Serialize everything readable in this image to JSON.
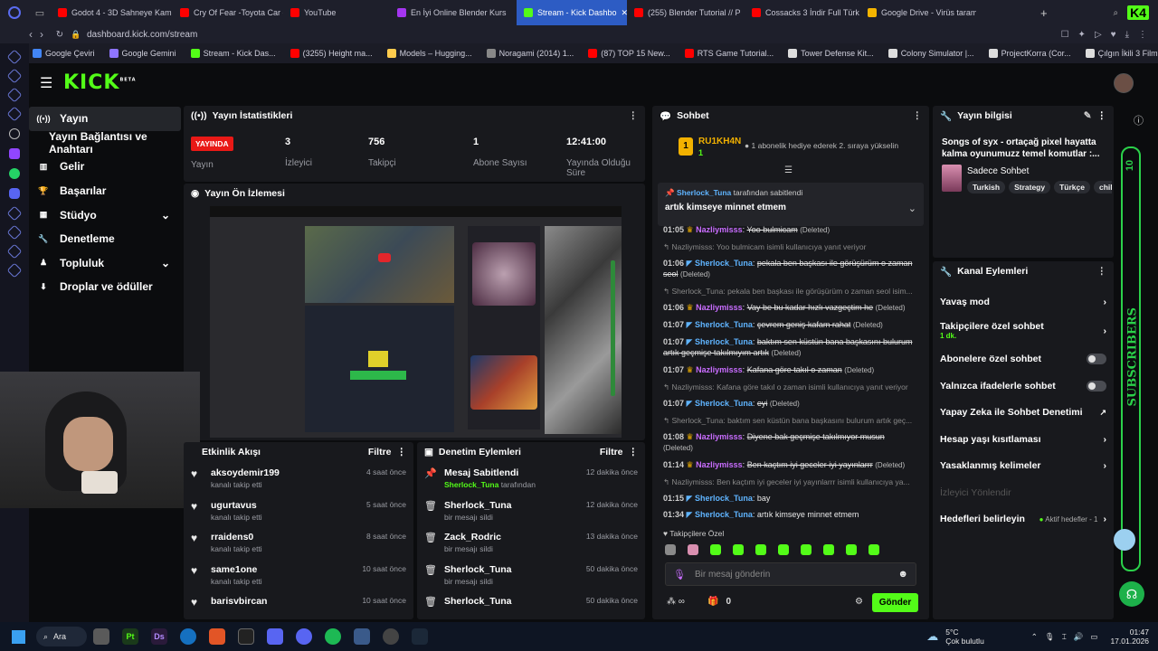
{
  "browser": {
    "tabs": [
      {
        "label": "Godot 4 - 3D Sahneye Kam",
        "color": "#ff0000"
      },
      {
        "label": "Cry Of Fear -Toyota Car -",
        "color": "#ff0000"
      },
      {
        "label": "YouTube",
        "color": "#ff0000"
      },
      {
        "label": "En İyi Online Blender Kurs",
        "color": "#a435f0"
      },
      {
        "label": "Stream - Kick Dashbo",
        "color": "#53fc18"
      },
      {
        "label": "(255) Blender Tutorial // P",
        "color": "#ff0000"
      },
      {
        "label": "Cossacks 3 İndir Full Türk",
        "color": "#ff0000"
      },
      {
        "label": "Google Drive - Virüs taram",
        "color": "#f4b400"
      }
    ],
    "url": "dashboard.kick.com/stream",
    "bookmarks": [
      {
        "label": "Google Çeviri",
        "color": "#4285f4"
      },
      {
        "label": "Google Gemini",
        "color": "#8e75ff"
      },
      {
        "label": "Stream - Kick Das...",
        "color": "#53fc18"
      },
      {
        "label": "(3255) Height ma...",
        "color": "#ff0000"
      },
      {
        "label": "Models – Hugging...",
        "color": "#ffcc4d"
      },
      {
        "label": "Noragami (2014) 1...",
        "color": "#888888"
      },
      {
        "label": "(87) TOP 15 New...",
        "color": "#ff0000"
      },
      {
        "label": "RTS Game Tutorial...",
        "color": "#ff0000"
      },
      {
        "label": "Tower Defense Kit...",
        "color": "#dddddd"
      },
      {
        "label": "Colony Simulator |...",
        "color": "#dddddd"
      },
      {
        "label": "ProjectKorra (Cor...",
        "color": "#dddddd"
      },
      {
        "label": "Çılgın İkili 3 Film iz...",
        "color": "#dddddd"
      }
    ]
  },
  "kick": {
    "logo": "KICK",
    "logo_sup": "BETA",
    "accent": "#53fc18",
    "sidebar": [
      {
        "label": "Yayın",
        "icon": "broadcast-icon",
        "glyph": "((•))"
      },
      {
        "label": "Yayın Bağlantısı ve Anahtarı",
        "icon": "none",
        "glyph": ""
      },
      {
        "label": "Gelir",
        "icon": "chart-icon",
        "glyph": "▥"
      },
      {
        "label": "Başarılar",
        "icon": "trophy-icon",
        "glyph": "🏆"
      },
      {
        "label": "Stüdyo",
        "icon": "studio-icon",
        "glyph": "▦"
      },
      {
        "label": "Denetleme",
        "icon": "wrench-icon",
        "glyph": "🔧"
      },
      {
        "label": "Topluluk",
        "icon": "community-icon",
        "glyph": "♟"
      },
      {
        "label": "Droplar ve ödüller",
        "icon": "drops-icon",
        "glyph": "⬇"
      }
    ],
    "stats": {
      "title": "Yayın İstatistikleri",
      "live_badge": "YAYINDA",
      "live_label": "Yayın",
      "items": [
        {
          "value": "3",
          "label": "İzleyici"
        },
        {
          "value": "756",
          "label": "Takipçi"
        },
        {
          "value": "1",
          "label": "Abone Sayısı"
        },
        {
          "value": "12:41:00",
          "label": "Yayında Olduğu Süre"
        }
      ]
    },
    "preview": {
      "title": "Yayın Ön İzlemesi"
    },
    "activity": {
      "title": "Etkinlik Akışı",
      "filter": "Filtre",
      "items": [
        {
          "name": "aksoydemir199",
          "sub": "kanalı takip etti",
          "time": "4 saat önce"
        },
        {
          "name": "ugurtavus",
          "sub": "kanalı takip etti",
          "time": "5 saat önce"
        },
        {
          "name": "rraidens0",
          "sub": "kanalı takip etti",
          "time": "8 saat önce"
        },
        {
          "name": "same1one",
          "sub": "kanalı takip etti",
          "time": "10 saat önce"
        },
        {
          "name": "barisvbircan",
          "sub": "",
          "time": "10 saat önce"
        }
      ]
    },
    "moderation": {
      "title": "Denetim Eylemleri",
      "filter": "Filtre",
      "items": [
        {
          "name": "Mesaj Sabitlendi",
          "sub_user": "Sherlock_Tuna",
          "sub": "tarafından",
          "time": "12 dakika önce",
          "icon": "pin-icon"
        },
        {
          "name": "Sherlock_Tuna",
          "sub_user": "",
          "sub": "bir mesajı sildi",
          "time": "12 dakika önce",
          "icon": "trash-icon"
        },
        {
          "name": "Zack_Rodric",
          "sub_user": "",
          "sub": "bir mesajı sildi",
          "time": "13 dakika önce",
          "icon": "trash-icon"
        },
        {
          "name": "Sherlock_Tuna",
          "sub_user": "",
          "sub": "bir mesajı sildi",
          "time": "50 dakika önce",
          "icon": "trash-icon"
        },
        {
          "name": "Sherlock_Tuna",
          "sub_user": "",
          "sub": "",
          "time": "50 dakika önce",
          "icon": "trash-icon"
        }
      ]
    },
    "chat": {
      "title": "Sohbet",
      "top_user": "RU1KH4N",
      "top_count": "1",
      "top_rank": "1",
      "promo": "1 abonelik hediye ederek 2. sıraya yükselin",
      "pinned_by": "Sherlock_Tuna",
      "pinned_suffix": "tarafından sabitlendi",
      "pinned_msg": "artık kimseye minnet etmem",
      "deleted": "(Deleted)",
      "lines": [
        {
          "time": "01:05",
          "user": "Nazliymisss",
          "ucls": "u2",
          "msg": "Yoo bulmicam",
          "deleted": true,
          "reply": ""
        },
        {
          "time": "",
          "user": "",
          "ucls": "",
          "msg": "",
          "deleted": false,
          "reply": "↰ Nazliymisss: Yoo bulmicam isimli kullanıcıya yanıt veriyor"
        },
        {
          "time": "01:06",
          "user": "Sherlock_Tuna",
          "ucls": "u1",
          "msg": "pekala ben başkası ile görüşürüm o zaman seol",
          "deleted": true,
          "reply": ""
        },
        {
          "time": "",
          "user": "",
          "ucls": "",
          "msg": "",
          "deleted": false,
          "reply": "↰ Sherlock_Tuna: pekala ben başkası ile görüşürüm o zaman seol isim..."
        },
        {
          "time": "01:06",
          "user": "Nazliymisss",
          "ucls": "u2",
          "msg": "Vay be bu kadar hızlı vazgeçtim he",
          "deleted": true,
          "reply": ""
        },
        {
          "time": "01:07",
          "user": "Sherlock_Tuna",
          "ucls": "u1",
          "msg": "çevrem geniş kafam rahat",
          "deleted": true,
          "reply": ""
        },
        {
          "time": "01:07",
          "user": "Sherlock_Tuna",
          "ucls": "u1",
          "msg": "baktım sen küstün bana başkasını bulurum artık geçmişe takılmıyım artık",
          "deleted": true,
          "reply": ""
        },
        {
          "time": "01:07",
          "user": "Nazliymisss",
          "ucls": "u2",
          "msg": "Kafana göre takıl o zaman",
          "deleted": true,
          "reply": ""
        },
        {
          "time": "",
          "user": "",
          "ucls": "",
          "msg": "",
          "deleted": false,
          "reply": "↰ Nazliymisss: Kafana göre takıl o zaman isimli kullanıcıya yanıt veriyor"
        },
        {
          "time": "01:07",
          "user": "Sherlock_Tuna",
          "ucls": "u1",
          "msg": "eyi",
          "deleted": true,
          "reply": ""
        },
        {
          "time": "",
          "user": "",
          "ucls": "",
          "msg": "",
          "deleted": false,
          "reply": "↰ Sherlock_Tuna: baktım sen küstün bana başkasını bulurum artık geç..."
        },
        {
          "time": "01:08",
          "user": "Nazliymisss",
          "ucls": "u2",
          "msg": "Diyene bak geçmişe takılmıyor musun",
          "deleted": true,
          "reply": ""
        },
        {
          "time": "01:14",
          "user": "Nazliymisss",
          "ucls": "u2",
          "msg": "Ben kaçtım iyi geceler iyi yayınlarrr",
          "deleted": true,
          "reply": ""
        },
        {
          "time": "",
          "user": "",
          "ucls": "",
          "msg": "",
          "deleted": false,
          "reply": "↰ Nazliymisss: Ben kaçtım iyi geceler iyi yayınlarrr isimli kullanıcıya ya..."
        },
        {
          "time": "01:15",
          "user": "Sherlock_Tuna",
          "ucls": "u1",
          "msg": "bay",
          "deleted": false,
          "reply": ""
        },
        {
          "time": "01:34",
          "user": "Sherlock_Tuna",
          "ucls": "u1",
          "msg": "artık kimseye minnet etmem",
          "deleted": false,
          "reply": ""
        }
      ],
      "followers_only": "Takipçilere Özel",
      "input_placeholder": "Bir mesaj gönderin",
      "points": "0",
      "send": "Gönder"
    },
    "stream_info": {
      "title": "Yayın bilgisi",
      "stream_title": "Songs of syx - ortaçağ pixel hayatta kalma oyunumuzz temel komutlar :...",
      "category": "Sadece Sohbet",
      "tags": [
        "Turkish",
        "Strategy",
        "Türkçe",
        "chil"
      ]
    },
    "channel_actions": {
      "title": "Kanal Eylemleri",
      "items": [
        {
          "label": "Yavaş mod",
          "kind": "arrow",
          "sub": ""
        },
        {
          "label": "Takipçilere özel sohbet",
          "kind": "arrow",
          "sub": "1 dk."
        },
        {
          "label": "Abonelere özel sohbet",
          "kind": "toggle",
          "sub": ""
        },
        {
          "label": "Yalnızca ifadelerle sohbet",
          "kind": "toggle",
          "sub": ""
        },
        {
          "label": "Yapay Zeka ile Sohbet Denetimi",
          "kind": "ext",
          "sub": ""
        },
        {
          "label": "Hesap yaşı kısıtlaması",
          "kind": "arrow",
          "sub": ""
        },
        {
          "label": "Yasaklanmış kelimeler",
          "kind": "arrow",
          "sub": ""
        }
      ],
      "disabled_item": "İzleyici Yönlendir",
      "goals_label": "Hedefleri belirleyin",
      "goals_status": "Aktif hedefler - 1"
    },
    "overlay": {
      "subscribers": "SUBSCRIBERS",
      "count": "10"
    }
  },
  "taskbar": {
    "search": "Ara",
    "weather_temp": "5°C",
    "weather_desc": "Çok bulutlu",
    "time": "01:47",
    "date": "17.01.2026"
  }
}
